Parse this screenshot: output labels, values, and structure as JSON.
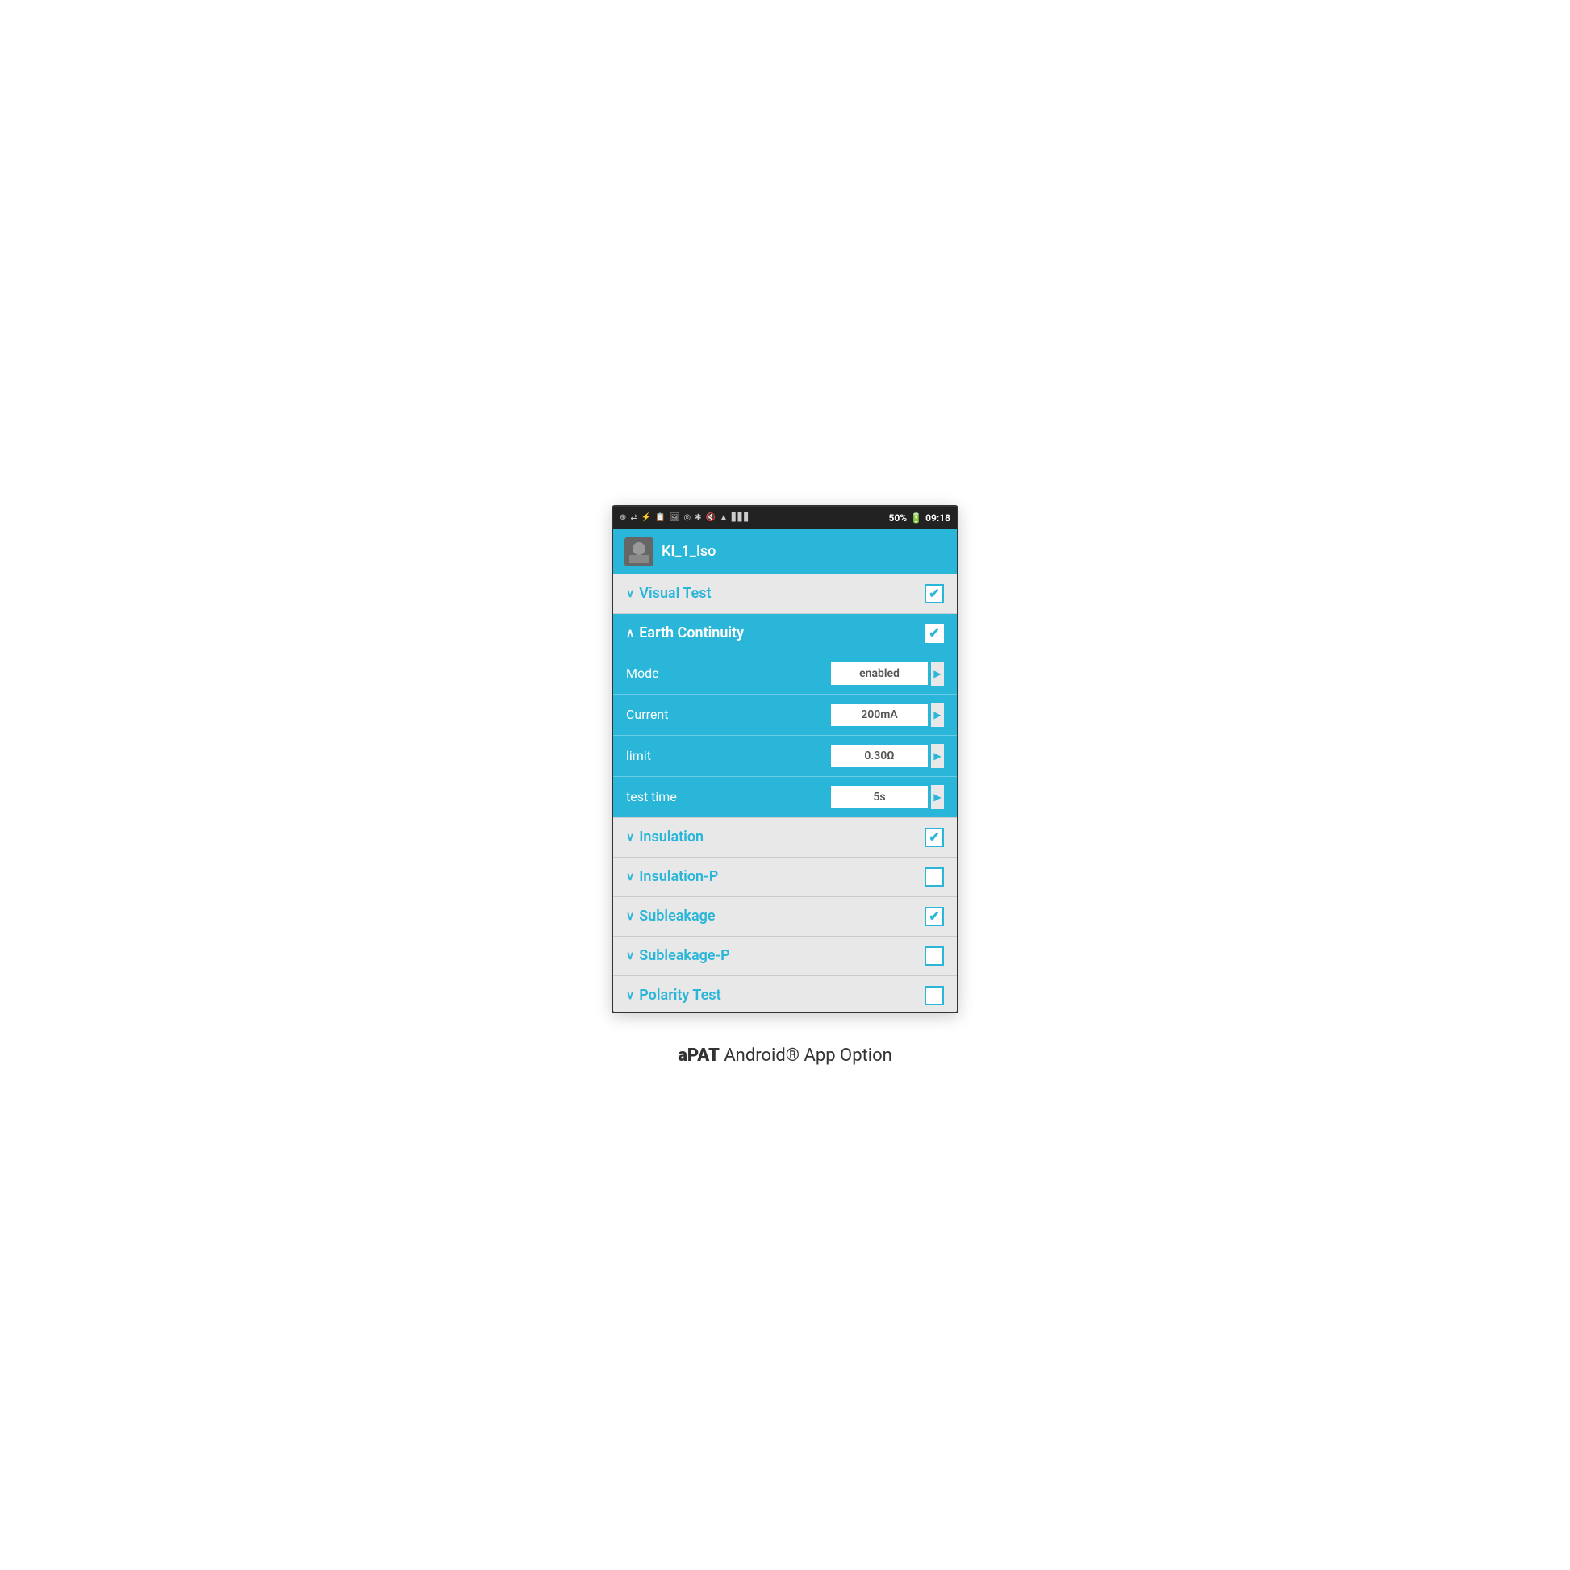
{
  "app": {
    "title": "KI_1_Iso",
    "time": "09:18",
    "battery": "50%"
  },
  "status_bar": {
    "icons": [
      "⊕",
      "☁",
      "↕",
      "📋",
      "🖼",
      "👁",
      "*",
      "🔇",
      "📶",
      "📶",
      "50%",
      "🔋"
    ]
  },
  "sections": [
    {
      "id": "visual-test",
      "label": "Visual Test",
      "chevron": "∨",
      "checked": true,
      "expanded": false
    },
    {
      "id": "earth-continuity",
      "label": "Earth Continuity",
      "chevron": "∧",
      "checked": true,
      "expanded": true,
      "rows": [
        {
          "label": "Mode",
          "value": "enabled"
        },
        {
          "label": "Current",
          "value": "200mA"
        },
        {
          "label": "limit",
          "value": "0.30Ω"
        },
        {
          "label": "test time",
          "value": "5s"
        }
      ]
    },
    {
      "id": "insulation",
      "label": "Insulation",
      "chevron": "∨",
      "checked": true,
      "expanded": false
    },
    {
      "id": "insulation-p",
      "label": "Insulation-P",
      "chevron": "∨",
      "checked": false,
      "expanded": false
    },
    {
      "id": "subleakage",
      "label": "Subleakage",
      "chevron": "∨",
      "checked": true,
      "expanded": false
    },
    {
      "id": "subleakage-p",
      "label": "Subleakage-P",
      "chevron": "∨",
      "checked": false,
      "expanded": false
    },
    {
      "id": "polarity-test",
      "label": "Polarity Test",
      "chevron": "∨",
      "checked": false,
      "expanded": false,
      "partial": true
    }
  ],
  "caption": {
    "bold": "aPAT",
    "normal": " Android® App Option"
  }
}
